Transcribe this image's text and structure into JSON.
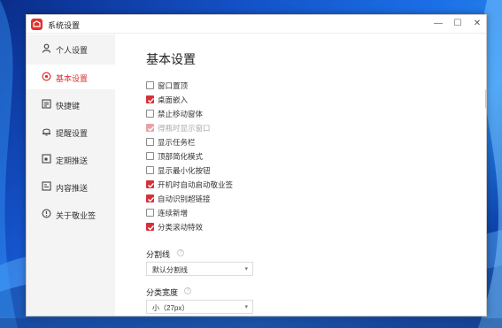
{
  "window": {
    "title": "系统设置",
    "controls": {
      "minimize": "—",
      "maximize": "☐",
      "close": "✕"
    }
  },
  "sidebar": {
    "items": [
      {
        "label": "个人设置",
        "icon": "user-icon",
        "active": false
      },
      {
        "label": "基本设置",
        "icon": "settings-icon",
        "active": true
      },
      {
        "label": "快捷键",
        "icon": "keyboard-icon",
        "active": false
      },
      {
        "label": "提醒设置",
        "icon": "bell-icon",
        "active": false
      },
      {
        "label": "定期推送",
        "icon": "calendar-icon",
        "active": false
      },
      {
        "label": "内容推送",
        "icon": "content-icon",
        "active": false
      },
      {
        "label": "关于敬业签",
        "icon": "info-icon",
        "active": false
      }
    ]
  },
  "main": {
    "heading": "基本设置",
    "options": [
      {
        "label": "窗口置顶",
        "checked": false,
        "disabled": false
      },
      {
        "label": "桌面嵌入",
        "checked": true,
        "disabled": false
      },
      {
        "label": "禁止移动窗体",
        "checked": false,
        "disabled": false
      },
      {
        "label": "得瓶时显示窗口",
        "checked": true,
        "disabled": true
      },
      {
        "label": "显示任务栏",
        "checked": false,
        "disabled": false
      },
      {
        "label": "顶部简化模式",
        "checked": false,
        "disabled": false
      },
      {
        "label": "显示最小化按钮",
        "checked": false,
        "disabled": false
      },
      {
        "label": "开机时自动启动敬业签",
        "checked": true,
        "disabled": false
      },
      {
        "label": "自动识别超链接",
        "checked": true,
        "disabled": false
      },
      {
        "label": "连续新增",
        "checked": false,
        "disabled": false
      },
      {
        "label": "分类滚动特效",
        "checked": true,
        "disabled": false
      }
    ],
    "divider": {
      "label": "分割线",
      "value": "默认分割线"
    },
    "category_width": {
      "label": "分类宽度",
      "value": "小（27px）"
    }
  },
  "colors": {
    "accent": "#e0302f",
    "sidebar_bg": "#f4f4f4"
  }
}
